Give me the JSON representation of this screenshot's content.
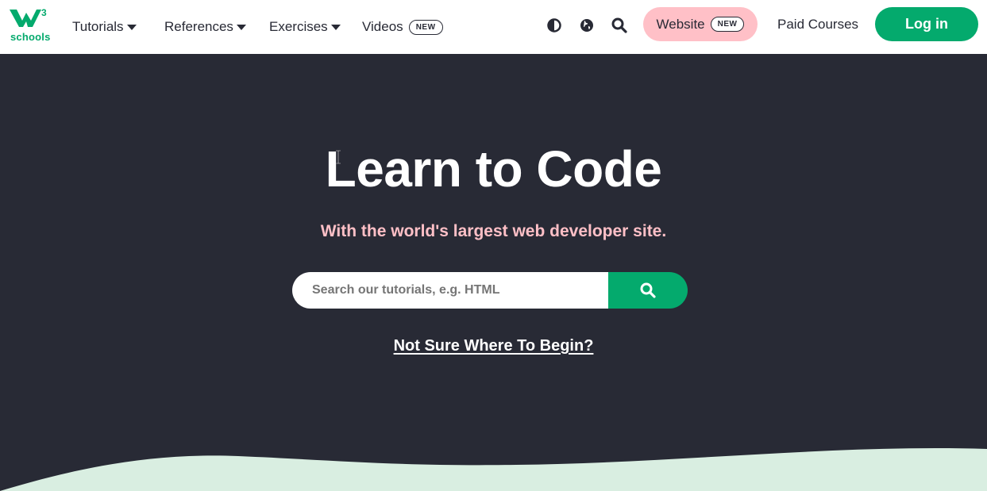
{
  "header": {
    "logo": {
      "mark": "w3",
      "superscript": "3",
      "text": "schools",
      "icon": "w3schools-logo-icon"
    },
    "nav": [
      {
        "label": "Tutorials",
        "dropdown": true
      },
      {
        "label": "References",
        "dropdown": true
      },
      {
        "label": "Exercises",
        "dropdown": true
      },
      {
        "label": "Videos",
        "badge": "NEW"
      }
    ],
    "icons": [
      "contrast-icon",
      "globe-icon",
      "search-icon"
    ],
    "website_button": {
      "label": "Website",
      "badge": "NEW"
    },
    "paid_courses": "Paid Courses",
    "login": "Log in"
  },
  "hero": {
    "title": "Learn to Code",
    "subtitle": "With the world's largest web developer site.",
    "search": {
      "placeholder": "Search our tutorials, e.g. HTML",
      "value": ""
    },
    "begin_link": "Not Sure Where To Begin?"
  },
  "colors": {
    "brand_green": "#04aa6d",
    "dark_bg": "#282a35",
    "pink": "#ffc0c7",
    "wave_light": "#d9eee1"
  }
}
